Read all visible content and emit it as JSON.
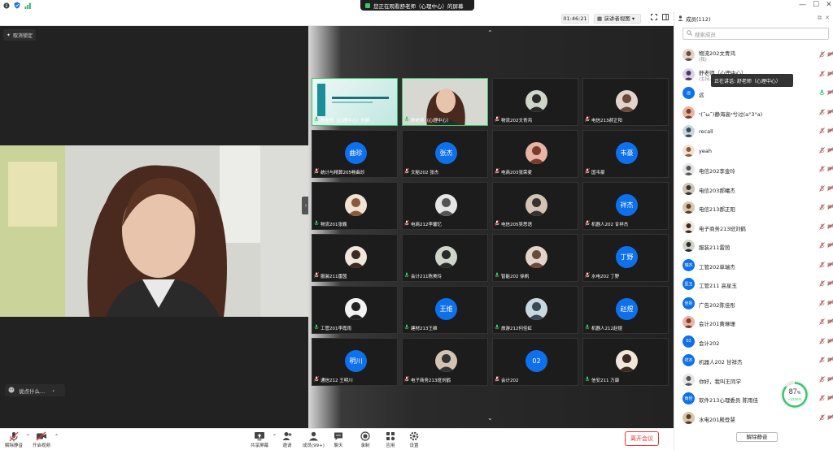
{
  "share_banner": "您正在观看舒老师（心理中心）的屏幕",
  "toolbar": {
    "timer": "01:46:21",
    "view_label": "演讲者视图"
  },
  "left": {
    "unpin_label": "取消锁定",
    "chat_placeholder": "说点什么..."
  },
  "tiles": [
    {
      "name": "舒老师（心理中心）的屏...",
      "kind": "screen",
      "muted": false
    },
    {
      "name": "舒老师（心理中心）",
      "kind": "video",
      "muted": false
    },
    {
      "name": "物流202文青鸿",
      "kind": "photo",
      "muted": true
    },
    {
      "name": "电信213郝正阳",
      "kind": "photo",
      "muted": true
    },
    {
      "name": "统计与精算205畅曲珍",
      "kind": "text",
      "avatar_text": "曲珍",
      "muted": true
    },
    {
      "name": "文秘202 张杰",
      "kind": "text",
      "avatar_text": "张杰",
      "muted": true
    },
    {
      "name": "电商203张荣麦",
      "kind": "photo",
      "muted": true
    },
    {
      "name": "国韦豪",
      "kind": "text",
      "avatar_text": "韦豪",
      "muted": true
    },
    {
      "name": "物流201张巍",
      "kind": "photo",
      "muted": false
    },
    {
      "name": "电商212李馨忆",
      "kind": "photo",
      "muted": true
    },
    {
      "name": "电信205吴思语",
      "kind": "photo",
      "muted": true
    },
    {
      "name": "机器人202 甘祥杰",
      "kind": "text",
      "avatar_text": "祥杰",
      "muted": true
    },
    {
      "name": "服装211雷茵",
      "kind": "photo",
      "muted": true
    },
    {
      "name": "会计211陈美玲",
      "kind": "photo",
      "muted": false
    },
    {
      "name": "智能202 徐帆",
      "kind": "photo",
      "muted": false
    },
    {
      "name": "水电202 丁野",
      "kind": "text",
      "avatar_text": "丁野",
      "muted": true
    },
    {
      "name": "工管201李霞雨",
      "kind": "photo",
      "muted": false
    },
    {
      "name": "建材213王维",
      "kind": "text",
      "avatar_text": "王维",
      "muted": false
    },
    {
      "name": "旅游212何佳虹",
      "kind": "photo",
      "muted": false
    },
    {
      "name": "机器人212赵煜",
      "kind": "text",
      "avatar_text": "赵煜",
      "muted": false
    },
    {
      "name": "通信212 王明川",
      "kind": "text",
      "avatar_text": "明川",
      "muted": true
    },
    {
      "name": "电子商务213班刘鹤",
      "kind": "photo",
      "muted": true
    },
    {
      "name": "会计202",
      "kind": "text",
      "avatar_text": "02",
      "muted": true
    },
    {
      "name": "信安211 万康",
      "kind": "photo",
      "muted": false
    }
  ],
  "members": {
    "title": "成员(112)",
    "search_placeholder": "搜索成员",
    "tooltip": "正在讲话: 舒老师（心理中心）",
    "items": [
      {
        "name": "物流202文青鸿",
        "sub": "(我)",
        "kind": "photo"
      },
      {
        "name": "舒老师（心理中心）",
        "sub": "(主持人)",
        "kind": "photo"
      },
      {
        "name": "远",
        "sub": "",
        "kind": "blue",
        "avatar_text": "远"
      },
      {
        "name": "ˢ(˘ω˘)静海高ᵒ兮过(a°3°a)",
        "sub": "",
        "kind": "photo"
      },
      {
        "name": "recall",
        "sub": "",
        "kind": "photo"
      },
      {
        "name": "yeah",
        "sub": "",
        "kind": "photo"
      },
      {
        "name": "电信202李金玲",
        "sub": "",
        "kind": "photo"
      },
      {
        "name": "电信203郝曦杰",
        "sub": "",
        "kind": "photo"
      },
      {
        "name": "电信213郝正阳",
        "sub": "",
        "kind": "photo"
      },
      {
        "name": "电子商务213班刘鹤",
        "sub": "",
        "kind": "photo"
      },
      {
        "name": "服装211雷茵",
        "sub": "",
        "kind": "photo"
      },
      {
        "name": "工管202单瑞杰",
        "sub": "",
        "kind": "blue",
        "avatar_text": "瑞杰"
      },
      {
        "name": "工管211 高星玉",
        "sub": "",
        "kind": "blue",
        "avatar_text": "星玉"
      },
      {
        "name": "广告202陈佳彤",
        "sub": "",
        "kind": "blue",
        "avatar_text": "佳彤"
      },
      {
        "name": "会计201黄琳珊",
        "sub": "",
        "kind": "photo"
      },
      {
        "name": "会计202",
        "sub": "",
        "kind": "blue",
        "avatar_text": "02"
      },
      {
        "name": "机器人202 甘祥杰",
        "sub": "",
        "kind": "blue",
        "avatar_text": "祥杰"
      },
      {
        "name": "你好，我叫王同学",
        "sub": "",
        "kind": "photo"
      },
      {
        "name": "软件213心理委员 陈雨佳",
        "sub": "",
        "kind": "blue",
        "avatar_text": "雨佳"
      },
      {
        "name": "水电201殿登慧",
        "sub": "",
        "kind": "photo"
      }
    ],
    "unmute_all": "解除静音"
  },
  "network": {
    "percent": "87",
    "unit": "%",
    "speed": "+222K/s"
  },
  "bottom": {
    "mute": "解除静音",
    "video": "开启视频",
    "share": "共享屏幕",
    "invite": "邀请",
    "members": "成员(99+)",
    "chat": "聊天",
    "record": "录制",
    "apps": "应用",
    "settings": "设置",
    "leave": "离开会议"
  },
  "colors": {
    "accent": "#0e71eb",
    "active": "#3ac56b",
    "danger": "#e33333"
  }
}
